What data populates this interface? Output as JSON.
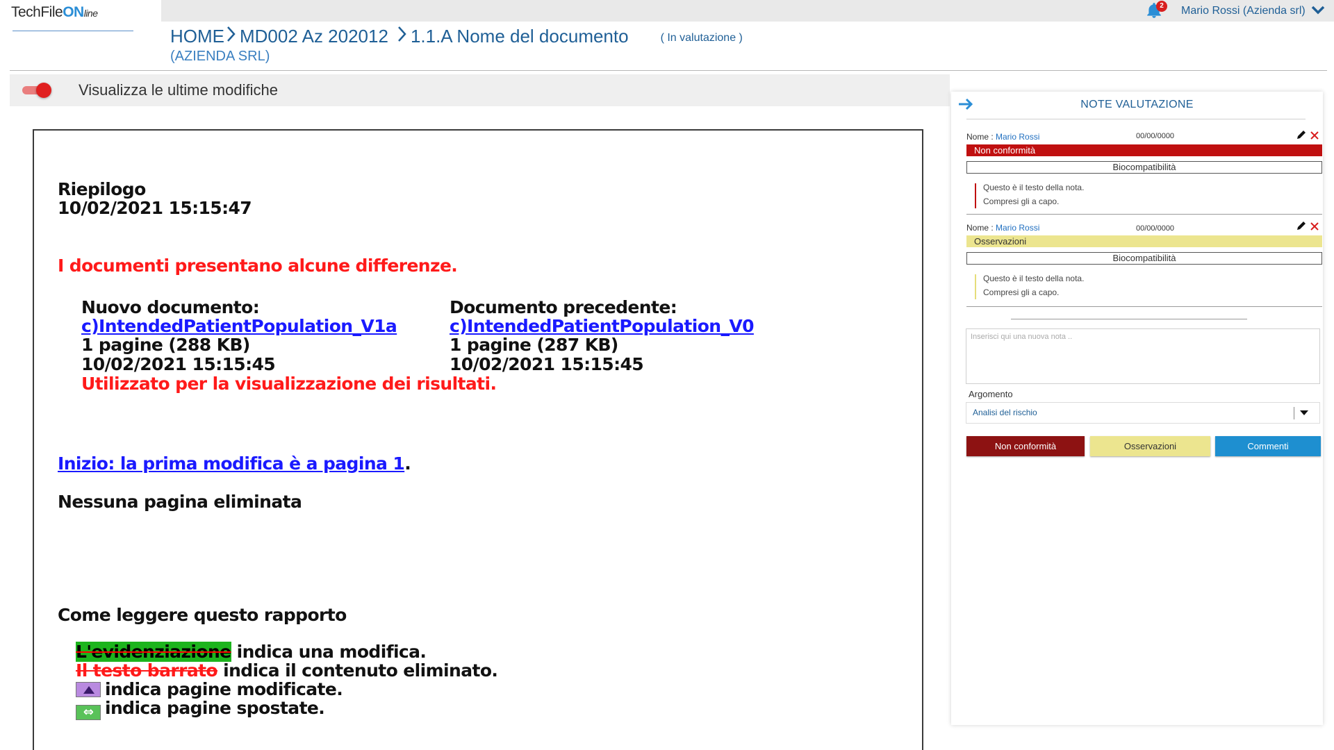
{
  "app": {
    "logo_main": "TechFile",
    "logo_on": "ON",
    "logo_line": "line"
  },
  "header": {
    "notifications_count": "2",
    "user_name": "Mario Rossi (Azienda srl)",
    "breadcrumb": [
      "HOME",
      "MD002 Az 202012",
      "1.1.A Nome del documento"
    ],
    "status": "( In valutazione )",
    "company": "(AZIENDA SRL)"
  },
  "toggle_bar": {
    "label": "Visualizza le ultime modifiche",
    "enabled": true
  },
  "document": {
    "summary_title": "Riepilogo",
    "summary_date": "10/02/2021 15:15:47",
    "differences": "I documenti presentano alcune differenze.",
    "new_doc": {
      "heading": "Nuovo documento:",
      "link": "c)IntendedPatientPopulation_V1a",
      "pages": "1 pagine (288 KB)",
      "date": "10/02/2021 15:15:45",
      "note": "Utilizzato per la visualizzazione dei risultati."
    },
    "prev_doc": {
      "heading": "Documento precedente:",
      "link": "c)IntendedPatientPopulation_V0",
      "pages": "1 pagine (287 KB)",
      "date": "10/02/2021 15:15:45"
    },
    "start_link": "Inizio: la prima modifica è a pagina 1",
    "start_dot": ".",
    "no_deleted": "Nessuna pagina eliminata",
    "howto_title": "Come leggere questo rapporto",
    "legend": {
      "highlight": "L'evidenziazione",
      "highlight_desc": " indica una modifica.",
      "strike": "Il testo barrato",
      "strike_desc": " indica il contenuto eliminato.",
      "modified_desc": "indica pagine modificate.",
      "moved_desc": "indica pagine spostate."
    }
  },
  "notes_panel": {
    "title": "NOTE VALUTAZIONE",
    "notes": [
      {
        "name_label": "Nome : ",
        "name": "Mario Rossi",
        "date": "00/00/0000",
        "type": "Non conformità",
        "topic": "Biocompatibilità",
        "text_line1": "Questo è il testo della nota.",
        "text_line2": "Compresi gli a capo."
      },
      {
        "name_label": "Nome : ",
        "name": "Mario Rossi",
        "date": "00/00/0000",
        "type": "Osservazioni",
        "topic": "Biocompatibilità",
        "text_line1": "Questo è il testo della nota.",
        "text_line2": "Compresi gli a capo."
      }
    ],
    "new_note_placeholder": "Inserisci qui una nuova nota ..",
    "argument_label": "Argomento",
    "argument_value": "Analisi del rischio",
    "buttons": {
      "non_conformity": "Non conformità",
      "observations": "Osservazioni",
      "comments": "Commenti"
    }
  },
  "colors": {
    "brand_blue": "#1f5f96",
    "non_conformity": "#c01010",
    "observations": "#ece58f",
    "comments": "#1e8fd0",
    "toggle_on": "#e02020"
  }
}
